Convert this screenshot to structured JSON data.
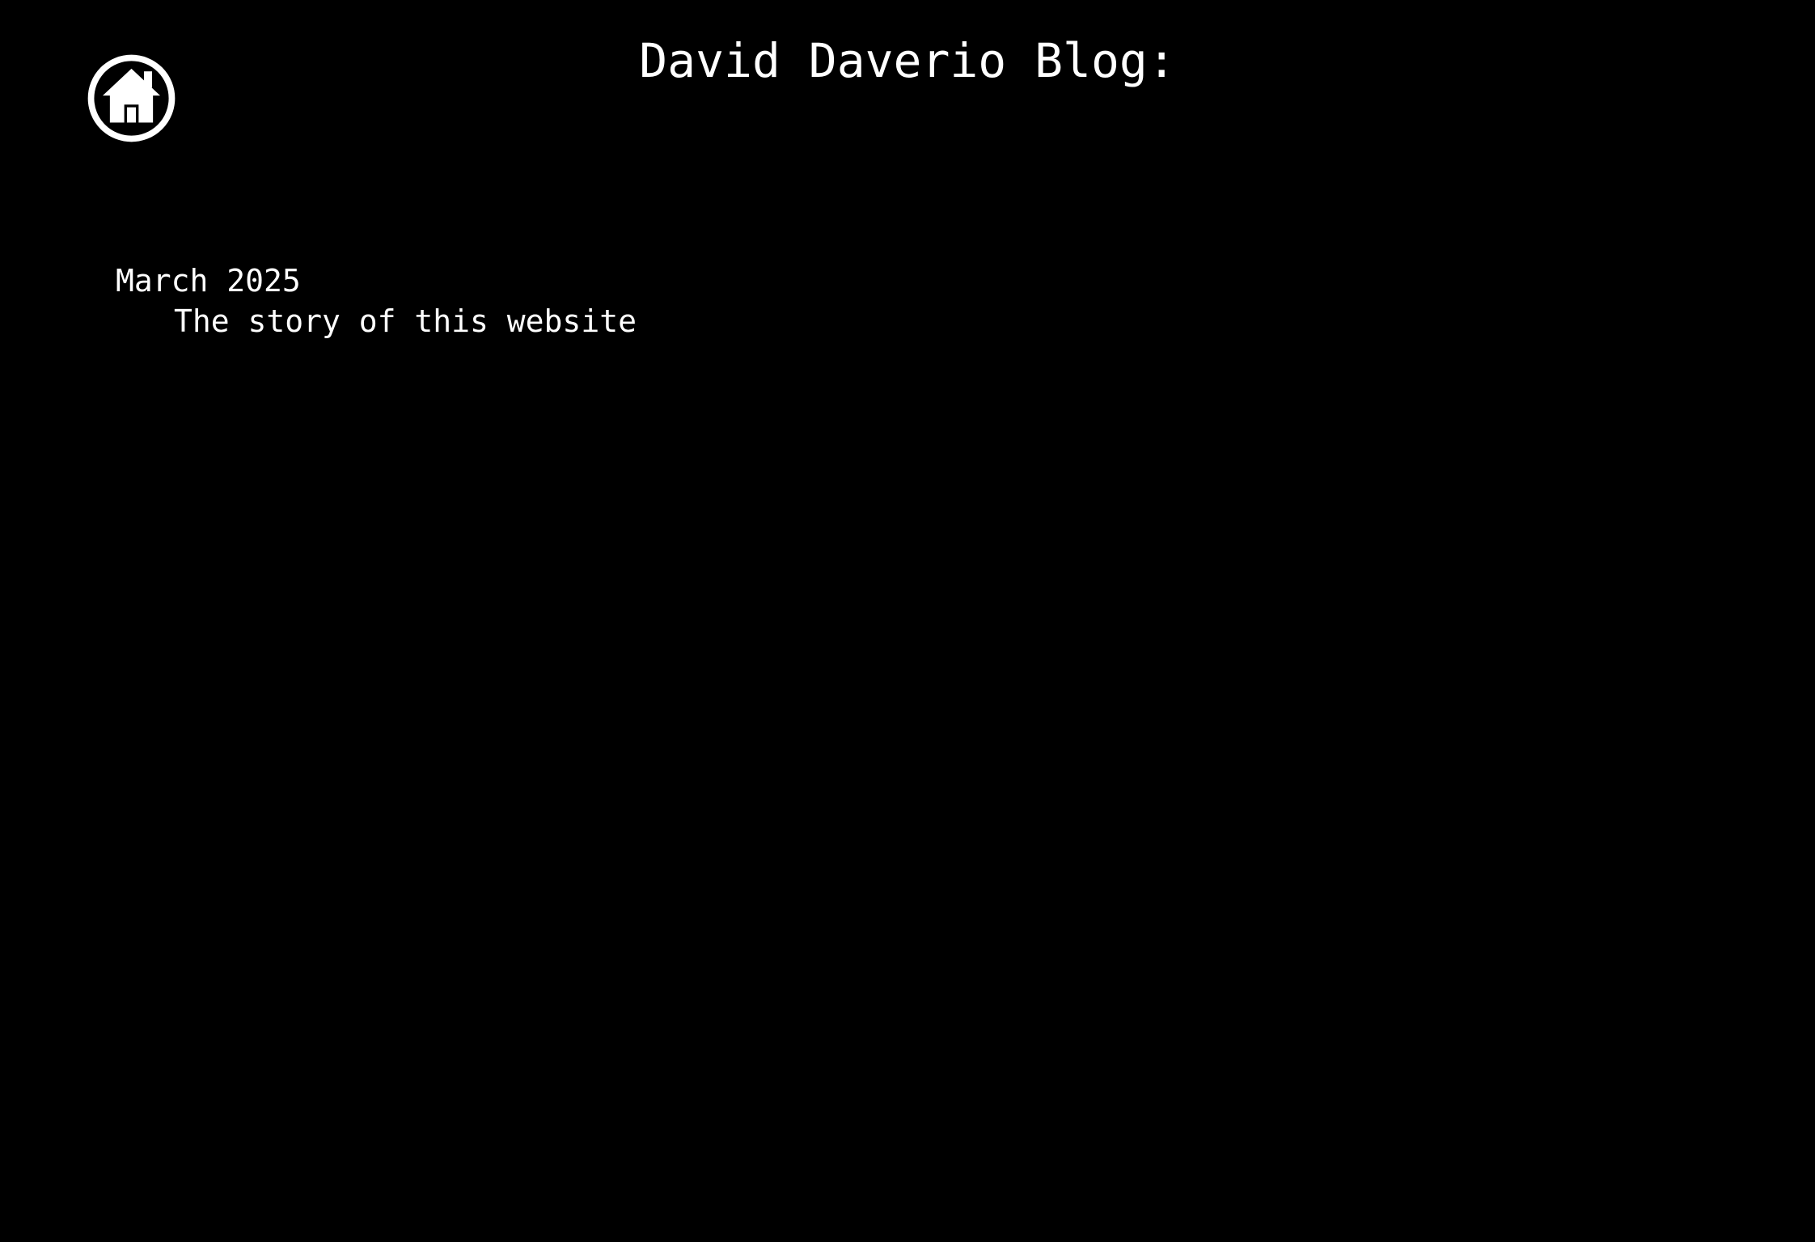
{
  "header": {
    "title": "David Daverio Blog:",
    "home_icon": "home-icon"
  },
  "archive": {
    "groups": [
      {
        "month": "March 2025",
        "posts": [
          {
            "title": "The story of this website"
          }
        ]
      }
    ]
  },
  "colors": {
    "background": "#000000",
    "text": "#ffffff"
  }
}
